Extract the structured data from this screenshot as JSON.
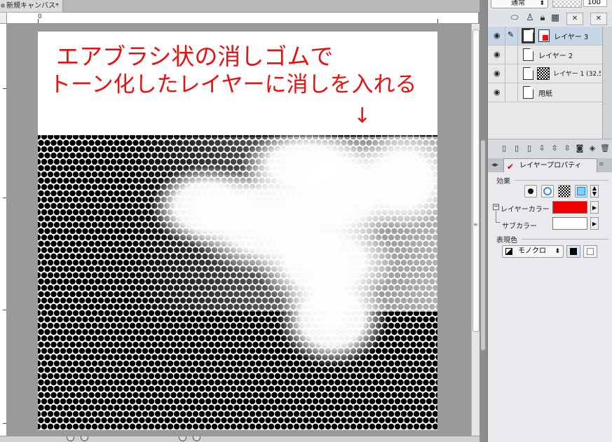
{
  "document": {
    "tab_title": "新規キャンバス*",
    "ruler_origin_label": "0",
    "annotation_line1": "エアブラシ状の消しゴムで",
    "annotation_line2": "トーン化したレイヤーに消しを入れる",
    "annotation_arrow": "↓",
    "annotation_color": "#e81010",
    "halftone_color": "#000000"
  },
  "layer_panel": {
    "blend_mode": "通常",
    "opacity": "100",
    "layers": [
      {
        "name": "レイヤー 3",
        "selected": true,
        "thumb": "color-page",
        "visible": true
      },
      {
        "name": "レイヤー 2",
        "selected": false,
        "thumb": "page",
        "visible": true
      },
      {
        "name": "レイヤー 1 (32.5",
        "selected": false,
        "thumb": "tone",
        "visible": true
      },
      {
        "name": "用紙",
        "selected": false,
        "thumb": "paper",
        "visible": true
      }
    ]
  },
  "layer_property": {
    "tab_label": "レイヤープロパティ",
    "effect_label": "効果",
    "layer_color_label": "レイヤーカラー",
    "layer_color": "#f00000",
    "sub_color_label": "サブカラー",
    "sub_color": "#ffffff",
    "expression_color_label": "表現色",
    "expression_color_value": "モノクロ"
  }
}
